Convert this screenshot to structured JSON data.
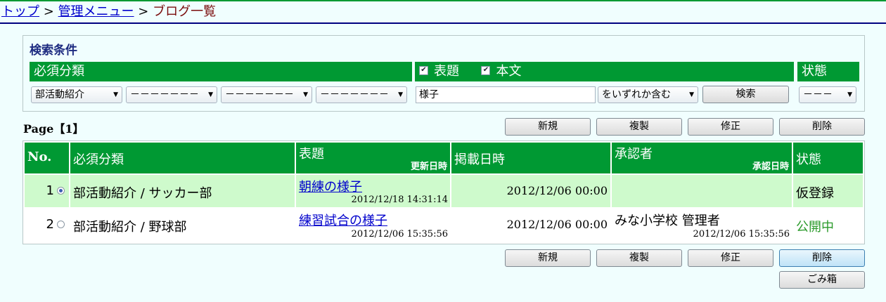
{
  "breadcrumb": {
    "top": "トップ",
    "sep1": ">",
    "admin": "管理メニュー",
    "sep2": ">",
    "current": "ブログ一覧"
  },
  "search": {
    "title": "検索条件",
    "category_header": "必須分類",
    "checkbox_title": "表題",
    "checkbox_body": "本文",
    "status_header": "状態",
    "category_selects": [
      "部活動紹介",
      "－－－－－－－",
      "－－－－－－－",
      "－－－－－－－"
    ],
    "keyword_value": "様子",
    "match_mode": "をいずれか含む",
    "search_button": "検索",
    "status_select": "－－－"
  },
  "page_info": "Page【1】",
  "actions": {
    "new": "新規",
    "copy": "複製",
    "edit": "修正",
    "delete": "削除",
    "trash": "ごみ箱"
  },
  "table": {
    "headers": {
      "no": "No.",
      "category": "必須分類",
      "title": "表題",
      "updated": "更新日時",
      "published": "掲載日時",
      "approver": "承認者",
      "approved": "承認日時",
      "status": "状態"
    },
    "rows": [
      {
        "no": "1",
        "selected": true,
        "category": "部活動紹介 / サッカー部",
        "title": "朝練の様子",
        "updated": "2012/12/18 14:31:14",
        "published": "2012/12/06 00:00",
        "approver": "",
        "approved": "",
        "status": "仮登録",
        "status_color": "#000000"
      },
      {
        "no": "2",
        "selected": false,
        "category": "部活動紹介 / 野球部",
        "title": "練習試合の様子",
        "updated": "2012/12/06 15:35:56",
        "published": "2012/12/06 00:00",
        "approver": "みな小学校 管理者",
        "approved": "2012/12/06 15:35:56",
        "status": "公開中",
        "status_color": "#2a9a2a"
      }
    ]
  }
}
